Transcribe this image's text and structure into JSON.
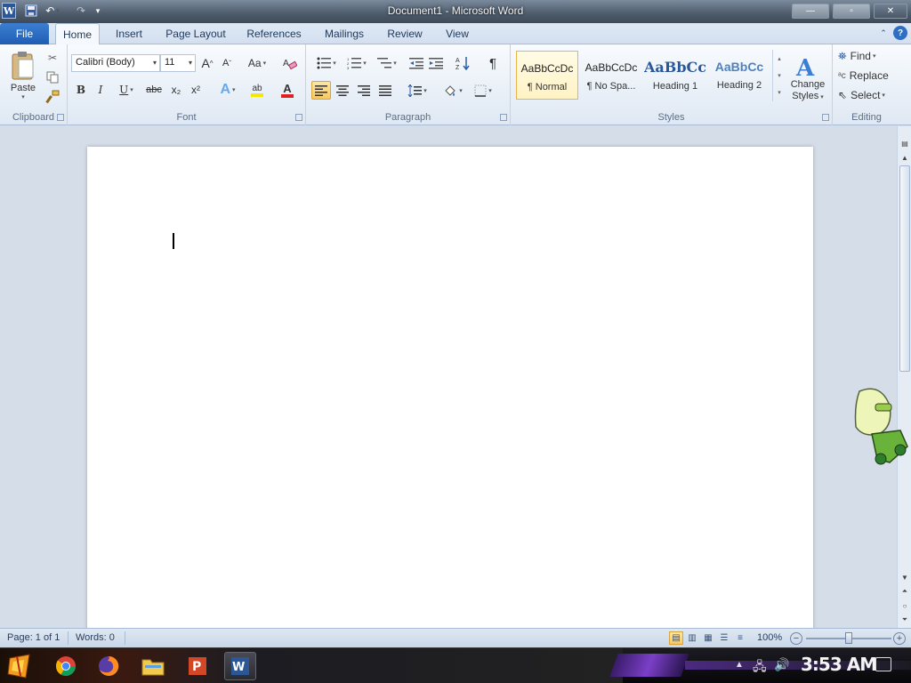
{
  "window": {
    "title": "Document1 - Microsoft Word",
    "app_icon": "word-icon",
    "controls": [
      "minimize-icon",
      "maximize-icon",
      "close-icon"
    ]
  },
  "quick_access": [
    "save-icon",
    "undo-icon",
    "redo-icon",
    "customize-icon"
  ],
  "ribbon_tabs": {
    "file": "File",
    "tabs": [
      "Home",
      "Insert",
      "Page Layout",
      "References",
      "Mailings",
      "Review",
      "View"
    ],
    "active": "Home"
  },
  "clipboard": {
    "paste": "Paste",
    "label": "Clipboard"
  },
  "font": {
    "label": "Font",
    "family": "Calibri (Body)",
    "size": "11",
    "grow": "A",
    "shrink": "A",
    "change_case": "Aa",
    "bold": "B",
    "italic": "I",
    "underline": "U",
    "strike": "abc",
    "subscript": "x₂",
    "superscript": "x²",
    "text_effects": "A",
    "highlight": "ab",
    "font_color": "A",
    "font_color_value": "#e02020",
    "highlight_color_value": "#f5e800"
  },
  "paragraph": {
    "label": "Paragraph",
    "pilcrow": "¶"
  },
  "styles": {
    "label": "Styles",
    "items": [
      {
        "sample": "AaBbCcDc",
        "name": "¶ Normal"
      },
      {
        "sample": "AaBbCcDc",
        "name": "¶ No Spa..."
      },
      {
        "sample": "AaBbCc",
        "name": "Heading 1"
      },
      {
        "sample": "AaBbCc",
        "name": "Heading 2"
      }
    ],
    "selected_index": 0,
    "change_styles_line1": "Change",
    "change_styles_line2": "Styles"
  },
  "editing": {
    "label": "Editing",
    "find": "Find",
    "replace": "Replace",
    "select": "Select"
  },
  "statusbar": {
    "page": "Page: 1 of 1",
    "words": "Words: 0",
    "zoom": "100%",
    "zoom_out": "−",
    "zoom_in": "+"
  },
  "taskbar": {
    "items": [
      "start-icon",
      "chrome-icon",
      "firefox-icon",
      "file-explorer-icon",
      "powerpoint-icon",
      "word-icon"
    ],
    "active": "word-icon",
    "time": "3:53 AM"
  }
}
